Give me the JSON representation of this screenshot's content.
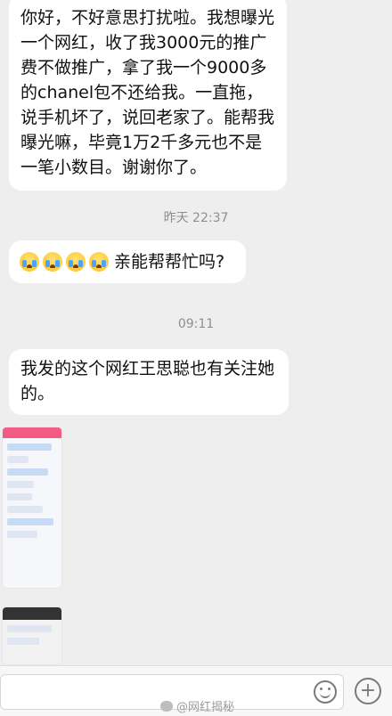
{
  "messages": [
    {
      "text": "你好，不好意思打扰啦。我想曝光一个网红，收了我3000元的推广费不做推广，拿了我一个9000多的chanel包不还给我。一直拖，说手机坏了，说回老家了。能帮我曝光嘛，毕竟1万2千多元也不是一笔小数目。谢谢你了。"
    },
    {
      "emoji_count": 4,
      "emoji_name": "crying-face-icon",
      "text": "亲能帮帮忙吗?"
    },
    {
      "text": "我发的这个网红王思聪也有关注她的。"
    }
  ],
  "timestamps": {
    "first": "昨天 22:37",
    "second": "09:11"
  },
  "input": {
    "placeholder": ""
  },
  "icons": {
    "emoji_button": "smiley-icon",
    "plus_button": "plus-icon",
    "plus_glyph": "+"
  },
  "watermark": "@网红揭秘"
}
